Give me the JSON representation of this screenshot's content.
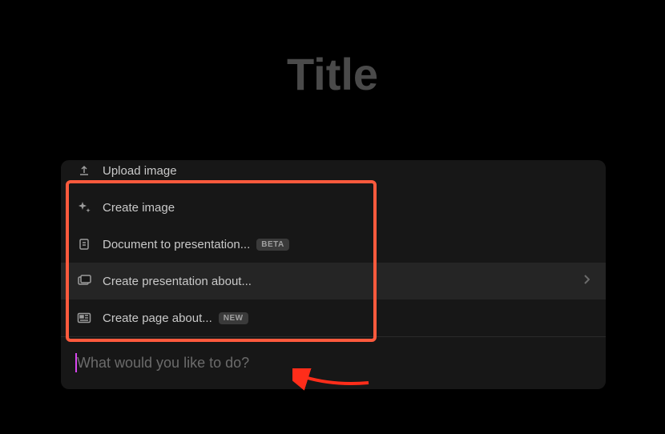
{
  "title": "Title",
  "menu": {
    "items": [
      {
        "label": "Upload image"
      },
      {
        "label": "Create image"
      },
      {
        "label": "Document to presentation...",
        "badge": "BETA"
      },
      {
        "label": "Create presentation about..."
      },
      {
        "label": "Create page about...",
        "badge": "NEW"
      }
    ]
  },
  "input": {
    "placeholder": "What would you like to do?"
  }
}
